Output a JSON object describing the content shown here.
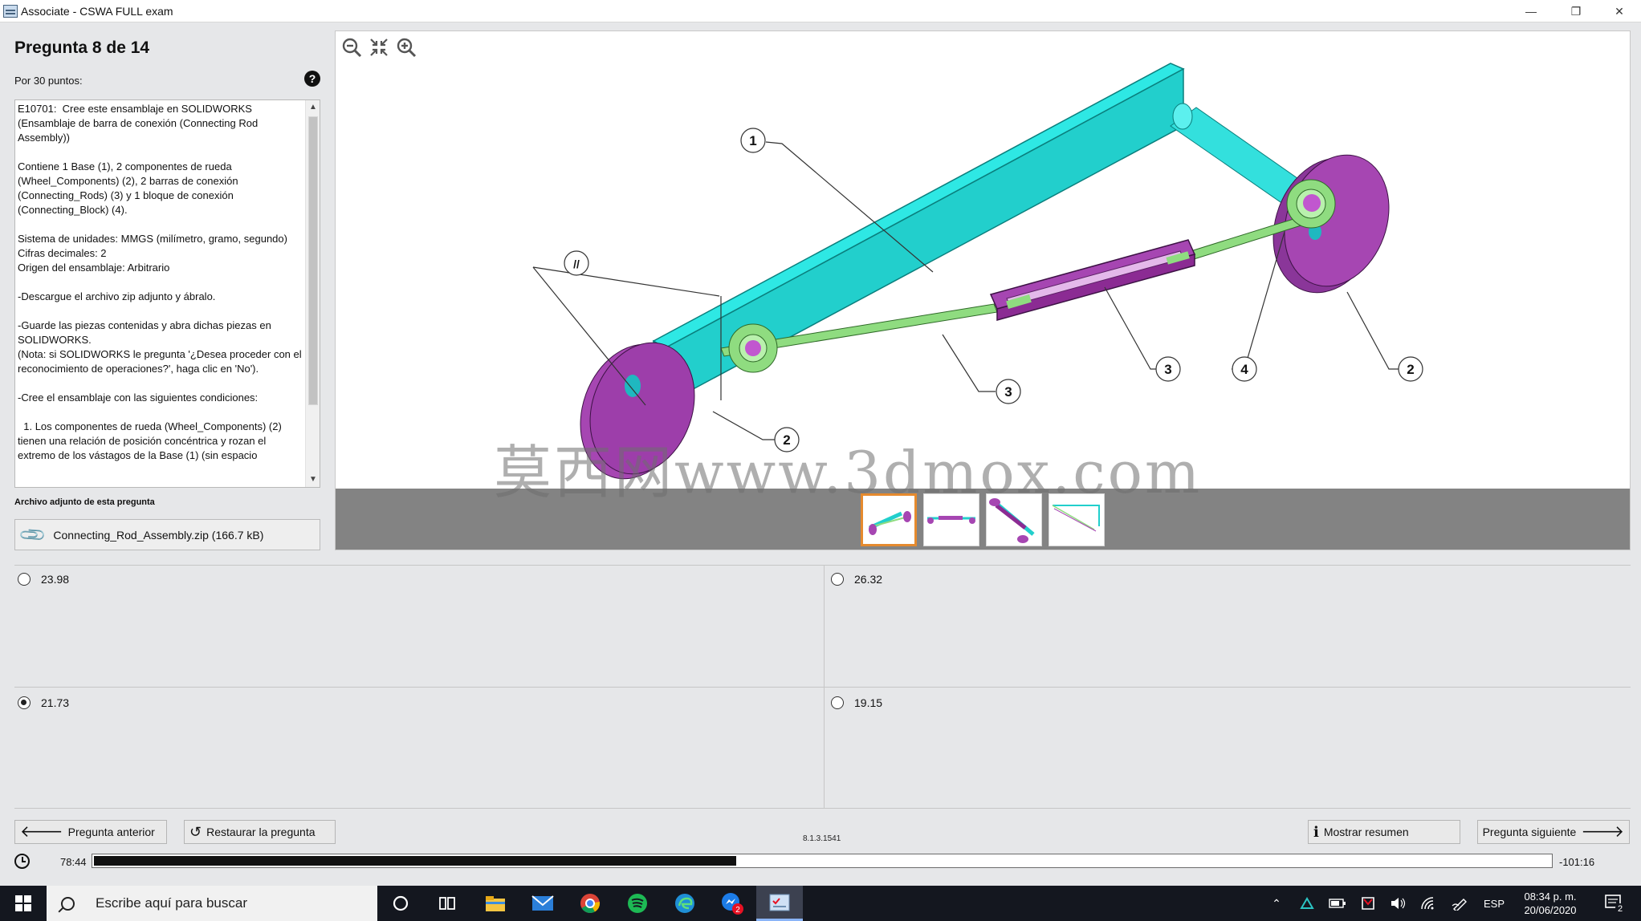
{
  "window": {
    "title": "Associate - CSWA FULL exam",
    "minimize": "—",
    "restore": "❐",
    "close": "✕"
  },
  "question": {
    "title": "Pregunta 8 de 14",
    "points_label": "Por 30 puntos:",
    "help": "?",
    "description": "E10701:  Cree este ensamblaje en SOLIDWORKS (Ensamblaje de barra de conexión (Connecting Rod Assembly))\n\nContiene 1 Base (1), 2 componentes de rueda (Wheel_Components) (2), 2 barras de conexión (Connecting_Rods) (3) y 1 bloque de conexión (Connecting_Block) (4).\n\nSistema de unidades: MMGS (milímetro, gramo, segundo)\nCifras decimales: 2\nOrigen del ensamblaje: Arbitrario\n\n-Descargue el archivo zip adjunto y ábralo.\n\n-Guarde las piezas contenidas y abra dichas piezas en SOLIDWORKS.\n(Nota: si SOLIDWORKS le pregunta '¿Desea proceder con el reconocimiento de operaciones?', haga clic en 'No').\n\n-Cree el ensamblaje con las siguientes condiciones:\n\n  1. Los componentes de rueda (Wheel_Components) (2) tienen una relación de posición concéntrica y rozan el extremo de los vástagos de la Base (1) (sin espacio"
  },
  "attachment": {
    "label": "Archivo adjunto de esta pregunta",
    "filename": "Connecting_Rod_Assembly.zip (166.7 kB)"
  },
  "viewer": {
    "callouts": [
      "1",
      "2",
      "2",
      "3",
      "3",
      "4",
      "//"
    ],
    "thumbnails": 4,
    "active_thumbnail": 0
  },
  "watermark": "莫西网www.3dmox.com",
  "answers": [
    {
      "value": "23.98",
      "selected": false
    },
    {
      "value": "26.32",
      "selected": false
    },
    {
      "value": "21.73",
      "selected": true
    },
    {
      "value": "19.15",
      "selected": false
    }
  ],
  "nav": {
    "previous": "Pregunta anterior",
    "restore": "Restaurar la pregunta",
    "version": "8.1.3.1541",
    "summary": "Mostrar resumen",
    "next": "Pregunta siguiente"
  },
  "timer": {
    "elapsed": "78:44",
    "remaining": "-101:16",
    "progress_fraction": 0.44
  },
  "taskbar": {
    "search_placeholder": "Escribe aquí para buscar",
    "language": "ESP",
    "time": "08:34 p. m.",
    "date": "20/06/2020",
    "notification_badge": "2",
    "edge_badge": "2"
  },
  "colors": {
    "base": "#22d3d0",
    "wheel": "#a646b2",
    "rod": "#8fdc80",
    "block": "#8b2b93",
    "thumb_active_border": "#e58a2e"
  }
}
